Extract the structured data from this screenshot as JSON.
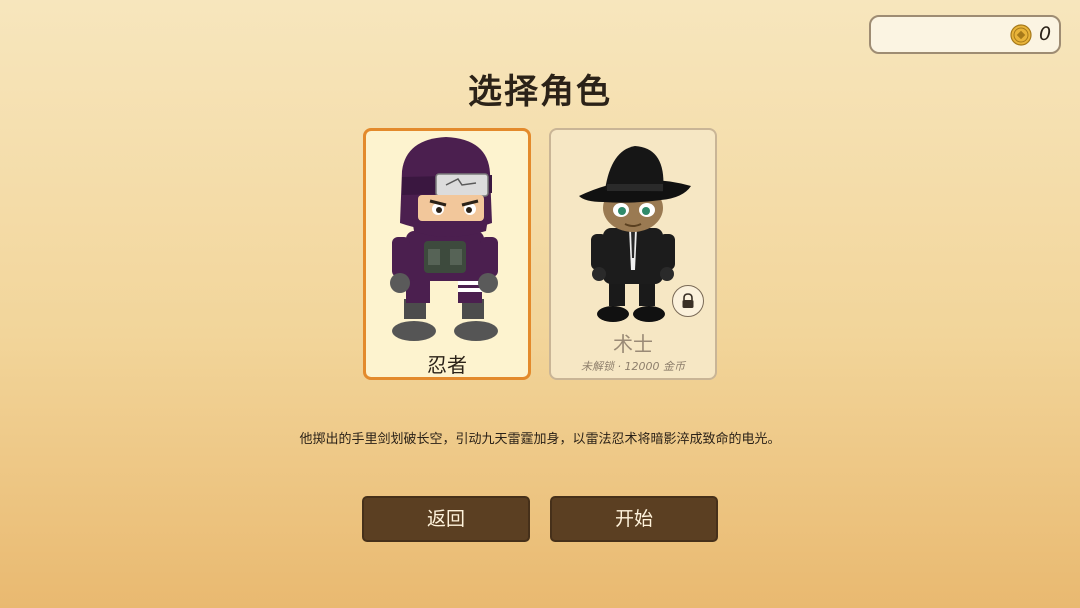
{
  "coins": {
    "count": "0",
    "icon": "gold-coin-icon"
  },
  "title": "选择角色",
  "characters": [
    {
      "name": "忍者",
      "selected": true,
      "locked": false
    },
    {
      "name": "术士",
      "selected": false,
      "locked": true,
      "status": "未解锁 · 12000 金币",
      "badge_icon": "lock-icon"
    }
  ],
  "description": "他掷出的手里剑划破长空，引动九天雷霆加身，以雷法忍术将暗影淬成致命的电光。",
  "buttons": {
    "back": "返回",
    "start": "开始"
  },
  "colors": {
    "selected_border": "#e38a2c",
    "button_bg": "#5b3f22",
    "ninja_purple": "#4b1f4f"
  }
}
